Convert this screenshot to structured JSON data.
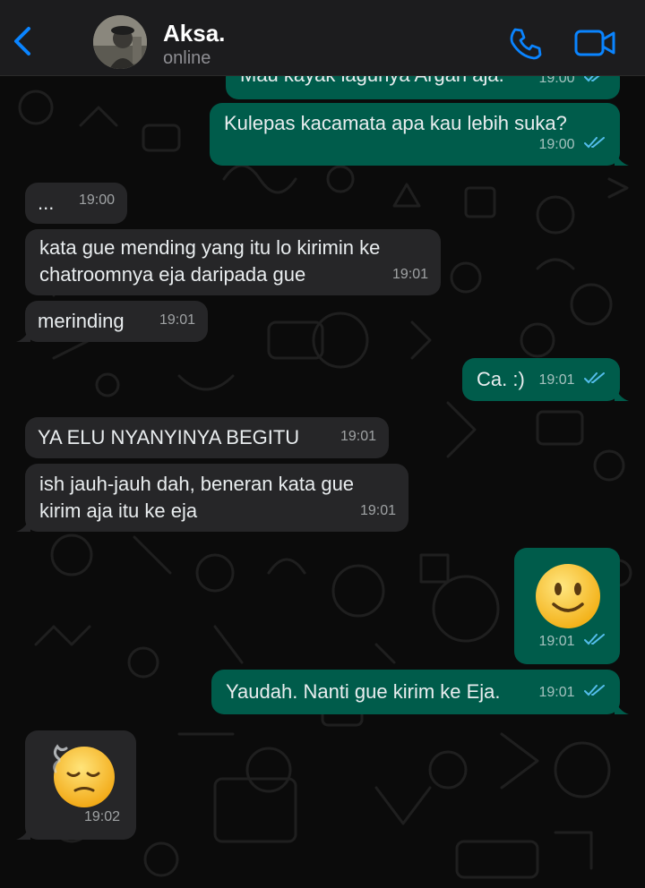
{
  "header": {
    "contact_name": "Aksa.",
    "status": "online"
  },
  "colors": {
    "accent": "#0a84ff",
    "incoming_bubble": "#262628",
    "outgoing_bubble": "#005c4b",
    "read_ticks": "#53bdeb"
  },
  "icons": {
    "back": "chevron-left-icon",
    "call": "phone-icon",
    "video": "video-camera-icon",
    "read": "double-check-icon"
  },
  "messages": [
    {
      "direction": "out",
      "text": "Mau kayak lagunya Argan aja.",
      "time": "19:00",
      "read": true
    },
    {
      "direction": "out",
      "text": "Kulepas kacamata apa kau lebih suka?",
      "time": "19:00",
      "read": true
    },
    {
      "direction": "in",
      "text": "...",
      "time": "19:00"
    },
    {
      "direction": "in",
      "text": "kata gue mending yang itu lo kirimin ke\nchatroomnya eja daripada gue",
      "time": "19:01"
    },
    {
      "direction": "in",
      "text": "merinding",
      "time": "19:01"
    },
    {
      "direction": "out",
      "text": "Ca. :)",
      "time": "19:01",
      "read": true
    },
    {
      "direction": "in",
      "text": "YA ELU NYANYINYA BEGITU",
      "time": "19:01"
    },
    {
      "direction": "in",
      "text": "ish jauh-jauh dah, beneran kata gue\nkirim aja itu ke eja",
      "time": "19:01"
    },
    {
      "direction": "out",
      "text": "🙂",
      "emoji": "slightly-smiling-face",
      "time": "19:01",
      "read": true
    },
    {
      "direction": "out",
      "text": "Yaudah. Nanti gue kirim ke Eja.",
      "time": "19:01",
      "read": true
    },
    {
      "direction": "in",
      "text": "😮‍💨",
      "emoji": "face-exhaling",
      "time": "19:02"
    }
  ]
}
